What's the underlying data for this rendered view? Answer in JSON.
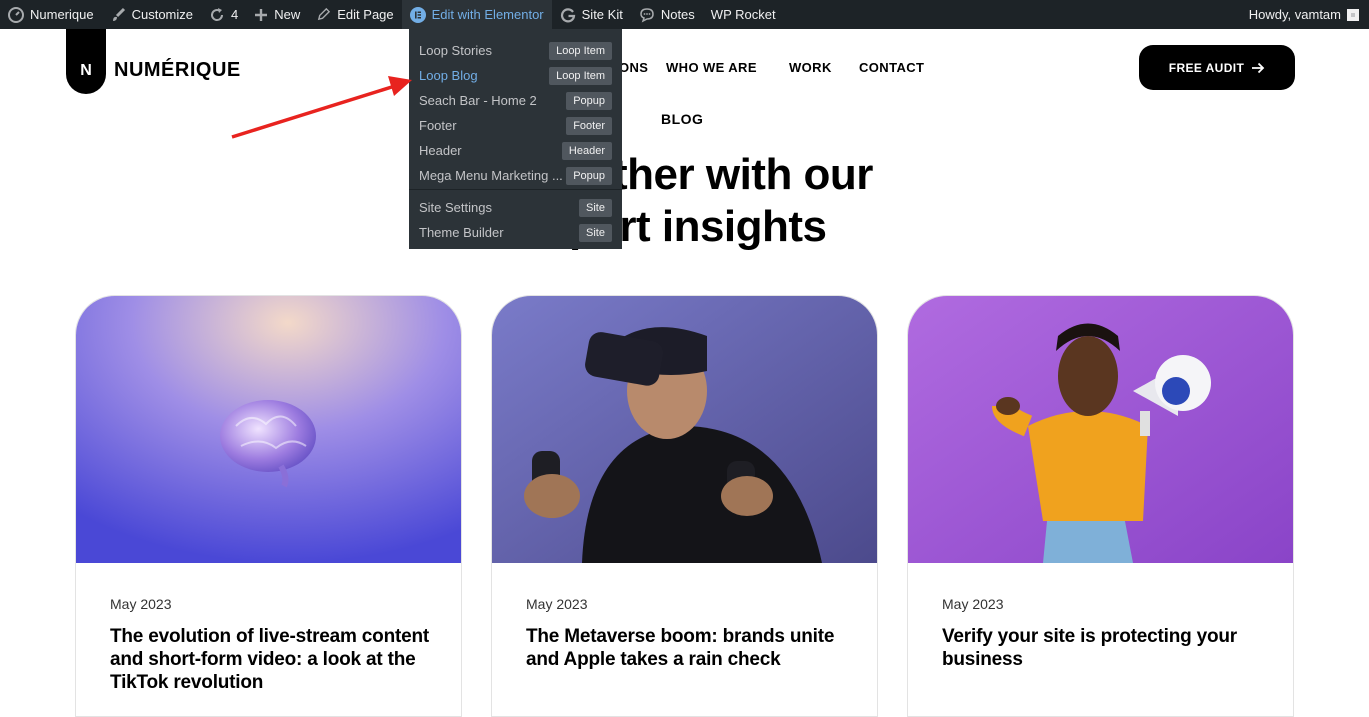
{
  "admin_bar": {
    "site_name": "Numerique",
    "customize": "Customize",
    "updates_count": "4",
    "new_label": "New",
    "edit_page": "Edit Page",
    "elementor": "Edit with Elementor",
    "site_kit": "Site Kit",
    "notes": "Notes",
    "wp_rocket": "WP Rocket",
    "howdy": "Howdy, vamtam"
  },
  "elementor_menu": {
    "items": [
      {
        "label": "Loop Stories",
        "badge": "Loop Item"
      },
      {
        "label": "Loop Blog",
        "badge": "Loop Item"
      },
      {
        "label": "Seach Bar - Home 2",
        "badge": "Popup"
      },
      {
        "label": "Footer",
        "badge": "Footer"
      },
      {
        "label": "Header",
        "badge": "Header"
      },
      {
        "label": "Mega Menu Marketing ...",
        "badge": "Popup"
      }
    ],
    "site_items": [
      {
        "label": "Site Settings",
        "badge": "Site"
      },
      {
        "label": "Theme Builder",
        "badge": "Site"
      }
    ]
  },
  "header": {
    "logo_letter": "N",
    "logo_text": "NUMÉRIQUE",
    "nav": {
      "solutions_partial": "ONS",
      "who_we_are": "WHO WE ARE",
      "work": "WORK",
      "contact": "CONTACT",
      "blog": "BLOG"
    },
    "cta_label": "FREE AUDIT"
  },
  "hero": {
    "line1": "urther with our",
    "line2": "pert insights"
  },
  "cards": [
    {
      "date": "May 2023",
      "title": "The evolution of live-stream content and short-form video: a look at the TikTok revolution"
    },
    {
      "date": "May 2023",
      "title": "The Metaverse boom: brands unite and Apple takes a rain check"
    },
    {
      "date": "May 2023",
      "title": "Verify your site is protecting your business"
    }
  ],
  "colors": {
    "admin_bar_bg": "#1d2327",
    "dropdown_bg": "#2c3338",
    "highlight": "#72aee6",
    "annotation_arrow": "#e8231f"
  }
}
